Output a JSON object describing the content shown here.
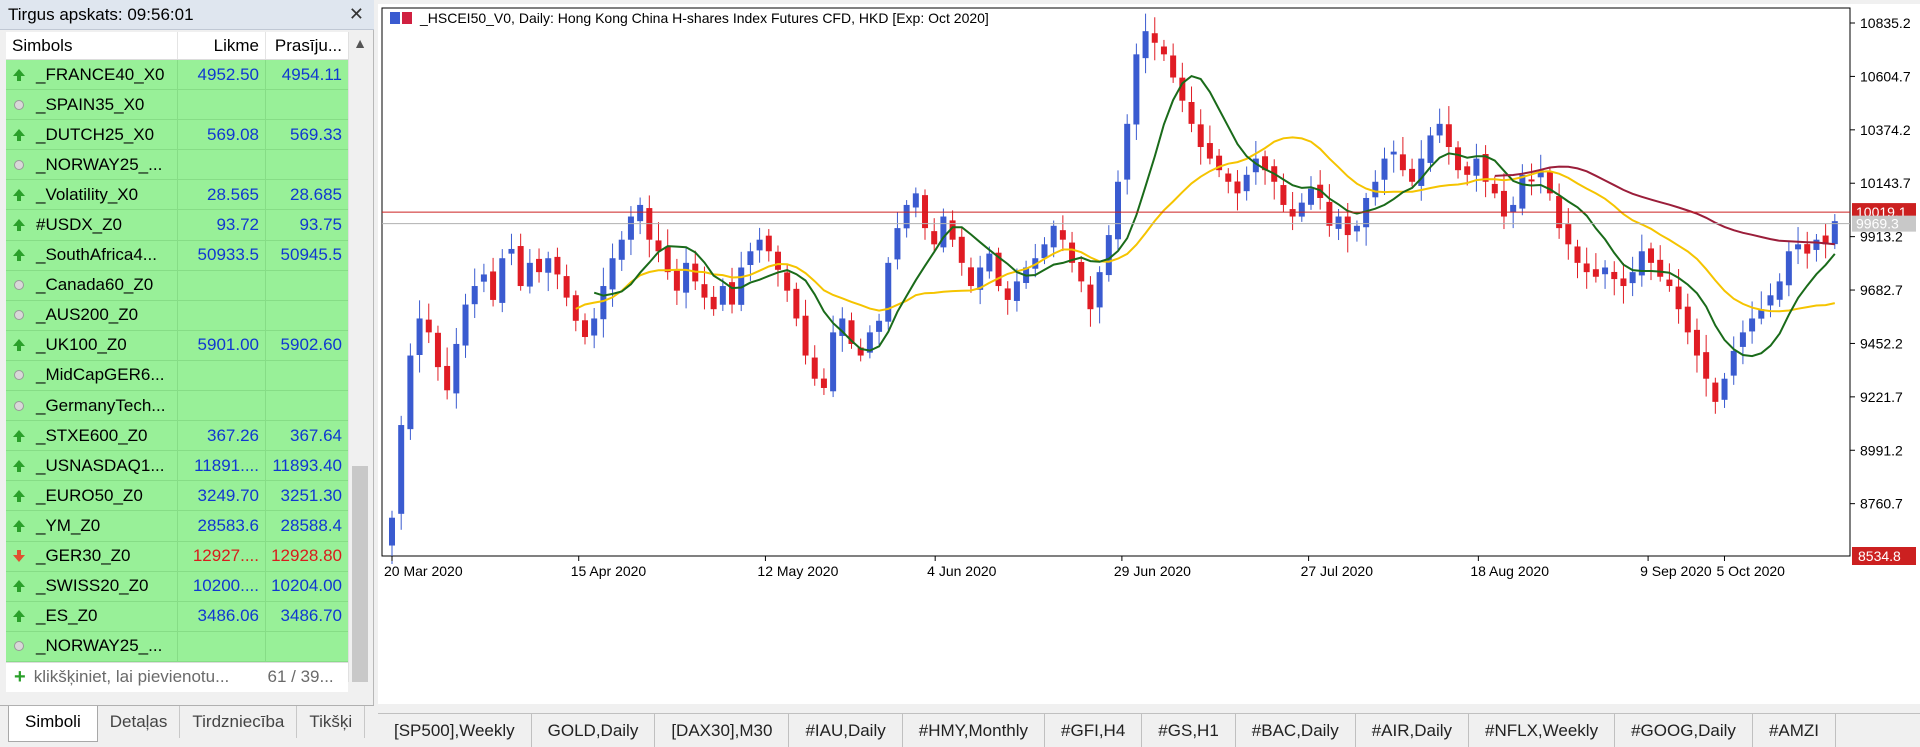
{
  "market_watch": {
    "title": "Tirgus apskats: 09:56:01",
    "close": "✕",
    "columns": {
      "symbol": "Simbols",
      "bid": "Likme",
      "ask": "Prasīju..."
    },
    "rows": [
      {
        "symbol": "_FRANCE40_X0",
        "bid": "4952.50",
        "ask": "4954.11",
        "dir": "up"
      },
      {
        "symbol": "_SPAIN35_X0",
        "bid": "",
        "ask": "",
        "dir": "none"
      },
      {
        "symbol": "_DUTCH25_X0",
        "bid": "569.08",
        "ask": "569.33",
        "dir": "up"
      },
      {
        "symbol": "_NORWAY25_...",
        "bid": "",
        "ask": "",
        "dir": "none"
      },
      {
        "symbol": "_Volatility_X0",
        "bid": "28.565",
        "ask": "28.685",
        "dir": "up"
      },
      {
        "symbol": "#USDX_Z0",
        "bid": "93.72",
        "ask": "93.75",
        "dir": "up"
      },
      {
        "symbol": "_SouthAfrica4...",
        "bid": "50933.5",
        "ask": "50945.5",
        "dir": "up"
      },
      {
        "symbol": "_Canada60_Z0",
        "bid": "",
        "ask": "",
        "dir": "none"
      },
      {
        "symbol": "_AUS200_Z0",
        "bid": "",
        "ask": "",
        "dir": "none"
      },
      {
        "symbol": "_UK100_Z0",
        "bid": "5901.00",
        "ask": "5902.60",
        "dir": "up"
      },
      {
        "symbol": "_MidCapGER6...",
        "bid": "",
        "ask": "",
        "dir": "none"
      },
      {
        "symbol": "_GermanyTech...",
        "bid": "",
        "ask": "",
        "dir": "none"
      },
      {
        "symbol": "_STXE600_Z0",
        "bid": "367.26",
        "ask": "367.64",
        "dir": "up"
      },
      {
        "symbol": "_USNASDAQ1...",
        "bid": "11891....",
        "ask": "11893.40",
        "dir": "up"
      },
      {
        "symbol": "_EURO50_Z0",
        "bid": "3249.70",
        "ask": "3251.30",
        "dir": "up"
      },
      {
        "symbol": "_YM_Z0",
        "bid": "28583.6",
        "ask": "28588.4",
        "dir": "up"
      },
      {
        "symbol": "_GER30_Z0",
        "bid": "12927....",
        "ask": "12928.80",
        "dir": "down"
      },
      {
        "symbol": "_SWISS20_Z0",
        "bid": "10200....",
        "ask": "10204.00",
        "dir": "up"
      },
      {
        "symbol": "_ES_Z0",
        "bid": "3486.06",
        "ask": "3486.70",
        "dir": "up"
      },
      {
        "symbol": "_NORWAY25_...",
        "bid": "",
        "ask": "",
        "dir": "none"
      }
    ],
    "add_text": "klikšķiniet, lai pievienotu...",
    "count": "61 / 39...",
    "tabs": [
      "Simboli",
      "Detaļas",
      "Tirdzniecība",
      "Tikšķi"
    ]
  },
  "chart": {
    "title": "_HSCEI50_V0, Daily:  Hong Kong China H-shares Index Futures CFD, HKD [Exp: Oct 2020]",
    "current_price_label": "10019.1",
    "bid_label": "9969.3",
    "low_label": "8534.8",
    "colors": {
      "bull": "#3a5bd0",
      "bear": "#e01c24",
      "ma_fast": "#1a6b1a",
      "ma_slow": "#f5c400",
      "ma_long": "#9b1e3a",
      "price_line": "#cc2020"
    }
  },
  "chart_data": {
    "type": "candlestick",
    "title": "_HSCEI50_V0, Daily:  Hong Kong China H-shares Index Futures CFD, HKD [Exp: Oct 2020]",
    "y_ticks": [
      "10835.2",
      "10604.7",
      "10374.2",
      "10143.7",
      "9913.2",
      "9682.7",
      "9452.2",
      "9221.7",
      "8991.2",
      "8760.7"
    ],
    "x_ticks": [
      "20 Mar 2020",
      "15 Apr 2020",
      "12 May 2020",
      "4 Jun 2020",
      "29 Jun 2020",
      "27 Jul 2020",
      "18 Aug 2020",
      "9 Sep 2020",
      "5 Oct 2020"
    ],
    "ylim": [
      8534.8,
      10900
    ],
    "current_price": 10019.1,
    "bid_price": 9969.3,
    "closes": [
      8700,
      9100,
      9400,
      9560,
      9500,
      9350,
      9250,
      9450,
      9620,
      9700,
      9750,
      9640,
      9820,
      9860,
      9700,
      9800,
      9760,
      9820,
      9750,
      9650,
      9550,
      9480,
      9560,
      9700,
      9820,
      9900,
      10000,
      10050,
      9900,
      9850,
      9760,
      9680,
      9800,
      9720,
      9650,
      9600,
      9700,
      9620,
      9780,
      9850,
      9900,
      9850,
      9770,
      9680,
      9560,
      9400,
      9300,
      9260,
      9500,
      9560,
      9450,
      9400,
      9500,
      9550,
      9800,
      9950,
      10050,
      10100,
      9950,
      9880,
      10000,
      9900,
      9800,
      9700,
      9780,
      9840,
      9700,
      9640,
      9720,
      9780,
      9820,
      9880,
      9960,
      9900,
      9800,
      9720,
      9600,
      9760,
      9920,
      10150,
      10400,
      10700,
      10800,
      10750,
      10700,
      10600,
      10500,
      10400,
      10300,
      10250,
      10200,
      10150,
      10100,
      10180,
      10250,
      10200,
      10150,
      10050,
      10000,
      10060,
      10120,
      10080,
      9960,
      10000,
      9920,
      9960,
      10080,
      10150,
      10250,
      10280,
      10200,
      10150,
      10250,
      10350,
      10400,
      10300,
      10200,
      10180,
      10250,
      10150,
      10100,
      10000,
      10050,
      10180,
      10160,
      10200,
      10100,
      9950,
      9880,
      9800,
      9760,
      9740,
      9780,
      9730,
      9700,
      9760,
      9850,
      9800,
      9740,
      9700,
      9600,
      9500,
      9400,
      9300,
      9200,
      9300,
      9420,
      9500,
      9560,
      9600,
      9660,
      9720,
      9850,
      9880,
      9840,
      9900,
      9880,
      9980
    ]
  },
  "chart_tabs": [
    "[SP500],Weekly",
    "GOLD,Daily",
    "[DAX30],M30",
    "#IAU,Daily",
    "#HMY,Monthly",
    "#GFI,H4",
    "#GS,H1",
    "#BAC,Daily",
    "#AIR,Daily",
    "#NFLX,Weekly",
    "#GOOG,Daily",
    "#AMZI"
  ]
}
